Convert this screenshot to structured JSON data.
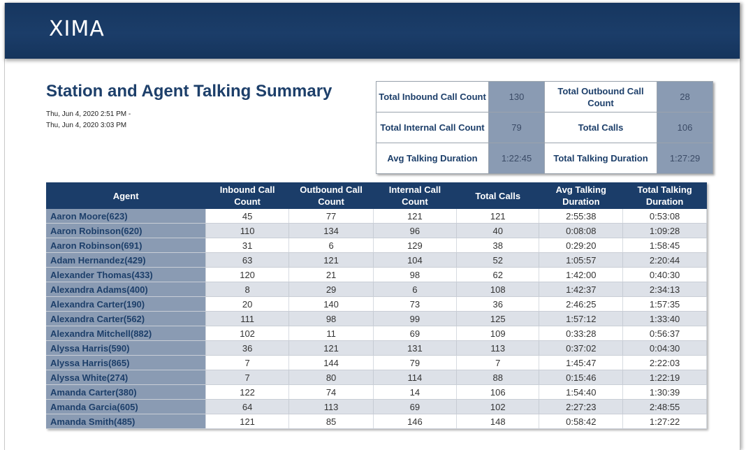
{
  "brand": {
    "logo_text": "XIMA"
  },
  "report": {
    "title": "Station and Agent Talking Summary",
    "date_start": "Thu, Jun 4, 2020 2:51 PM -",
    "date_end": "Thu, Jun 4, 2020 3:03 PM"
  },
  "summary": {
    "total_inbound_label": "Total Inbound Call Count",
    "total_inbound_value": "130",
    "total_outbound_label": "Total Outbound Call Count",
    "total_outbound_value": "28",
    "total_internal_label": "Total Internal Call Count",
    "total_internal_value": "79",
    "total_calls_label": "Total Calls",
    "total_calls_value": "106",
    "avg_talking_label": "Avg Talking Duration",
    "avg_talking_value": "1:22:45",
    "total_talking_label": "Total Talking Duration",
    "total_talking_value": "1:27:29"
  },
  "table": {
    "headers": [
      "Agent",
      "Inbound Call Count",
      "Outbound Call Count",
      "Internal Call Count",
      "Total Calls",
      "Avg Talking Duration",
      "Total Talking Duration"
    ],
    "rows": [
      [
        "Aaron Moore(623)",
        "45",
        "77",
        "121",
        "121",
        "2:55:38",
        "0:53:08"
      ],
      [
        "Aaron Robinson(620)",
        "110",
        "134",
        "96",
        "40",
        "0:08:08",
        "1:09:28"
      ],
      [
        "Aaron Robinson(691)",
        "31",
        "6",
        "129",
        "38",
        "0:29:20",
        "1:58:45"
      ],
      [
        "Adam Hernandez(429)",
        "63",
        "121",
        "104",
        "52",
        "1:05:57",
        "2:20:44"
      ],
      [
        "Alexander Thomas(433)",
        "120",
        "21",
        "98",
        "62",
        "1:42:00",
        "0:40:30"
      ],
      [
        "Alexandra Adams(400)",
        "8",
        "29",
        "6",
        "108",
        "1:42:37",
        "2:34:13"
      ],
      [
        "Alexandra Carter(190)",
        "20",
        "140",
        "73",
        "36",
        "2:46:25",
        "1:57:35"
      ],
      [
        "Alexandra Carter(562)",
        "111",
        "98",
        "99",
        "125",
        "1:57:12",
        "1:33:40"
      ],
      [
        "Alexandra Mitchell(882)",
        "102",
        "11",
        "69",
        "109",
        "0:33:28",
        "0:56:37"
      ],
      [
        "Alyssa Harris(590)",
        "36",
        "121",
        "131",
        "113",
        "0:37:02",
        "0:04:30"
      ],
      [
        "Alyssa Harris(865)",
        "7",
        "144",
        "79",
        "7",
        "1:45:47",
        "2:22:03"
      ],
      [
        "Alyssa White(274)",
        "7",
        "80",
        "114",
        "88",
        "0:15:46",
        "1:22:19"
      ],
      [
        "Amanda Carter(380)",
        "122",
        "74",
        "14",
        "106",
        "1:54:40",
        "1:30:39"
      ],
      [
        "Amanda Garcia(605)",
        "64",
        "113",
        "69",
        "102",
        "2:27:23",
        "2:48:55"
      ],
      [
        "Amanda Smith(485)",
        "121",
        "85",
        "146",
        "148",
        "0:58:42",
        "1:27:22"
      ]
    ]
  }
}
